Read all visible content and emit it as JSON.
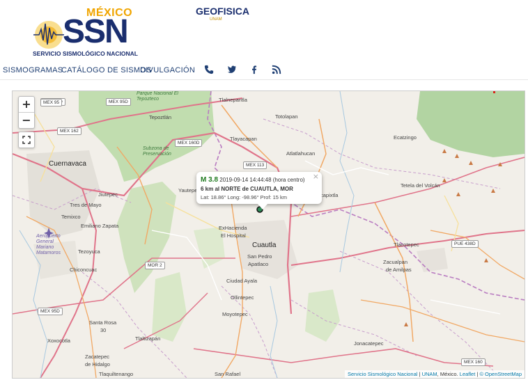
{
  "header": {
    "logo_country": "MÉXICO",
    "logo_acronym": "SSN",
    "logo_name": "SERVICIO SISMOLÓGICO NACIONAL",
    "partner_logo": "GEOFISICA",
    "partner_sub": "UNAM"
  },
  "nav": {
    "items": [
      "SISMOGRAMAS",
      "CATÁLOGO DE SISMOS",
      "DIVULGACIÓN"
    ],
    "icons": [
      "phone-icon",
      "twitter-icon",
      "facebook-icon",
      "rss-icon"
    ],
    "color": "#1f3f73"
  },
  "map": {
    "zoom_in": "+",
    "zoom_out": "−",
    "popup": {
      "magnitude": "M 3.8",
      "datetime": "2019-09-14  14:44:48 (hora centro)",
      "location": "6 km al NORTE de CUAUTLA, MOR",
      "coords": "Lat: 18.86°  Long: -98.96°  Prof: 15 km",
      "close": "×"
    },
    "attribution": {
      "ssn": "Servicio Sismológico Nacional",
      "unam": "UNAM",
      "place": ", México.",
      "leaflet": "Leaflet",
      "osm": "© OpenStreetMap"
    },
    "labels": {
      "cuernavaca": "Cuernavaca",
      "cuautla": "Cuautla",
      "tlalnepantla": "Tlalnepantla",
      "totolapan": "Totolapan",
      "tepoztlan": "Tepoztlán",
      "tlayacapan": "Tlayacapan",
      "atlatlahucan": "Atlatlahucan",
      "ecatzingo": "Ecatzingo",
      "yautepec": "Yautepec",
      "yecapixtla": "capixtla",
      "tetela": "Tetela del Volcán",
      "jiutepec": "Jiutepec",
      "tres_de_mayo": "Tres de Mayo",
      "temixco": "Temixco",
      "emiliano": "Emiliano Zapata",
      "hacienda": "ExHacienda",
      "hospital": "El Hospital",
      "tlacotepec": "Tlacotepec",
      "tezoyuca": "Tezoyuca",
      "chiconcuac": "Chiconcuac",
      "san_pedro": "San Pedro",
      "apatlaco": "Apatlaco",
      "zacualpan": "Zacualpan",
      "amilpas": "de Amilpas",
      "ayala": "Ciudad Ayala",
      "ollintepec": "Ollintepec",
      "moyotepec": "Moyotepec",
      "santa_rosa": "Santa Rosa",
      "santa_rosa_30": "30",
      "xoxocotla": "Xoxocotla",
      "tlaltizapan": "Tlaltizapán",
      "jonacatepec": "Jonacatepec",
      "zacatepec": "Zacatepec",
      "de_hidalgo": "de Hidalgo",
      "tlaquiltenango": "Tlaquiltenango",
      "san_rafael": "San Rafael",
      "parque": "Parque Nacional El Tepozteco",
      "subzona": "Subzona de Preservación",
      "aeropuerto": "Aeropuerto General Mariano Matamoros"
    },
    "shields": [
      "MEX 95D",
      "MEX 95",
      "MEX 162",
      "MEX 160D",
      "MEX 113",
      "PUE 438D",
      "MOR 2",
      "MEX 95D",
      "MEX 160"
    ],
    "epicenter_color": "#2e8b57"
  }
}
